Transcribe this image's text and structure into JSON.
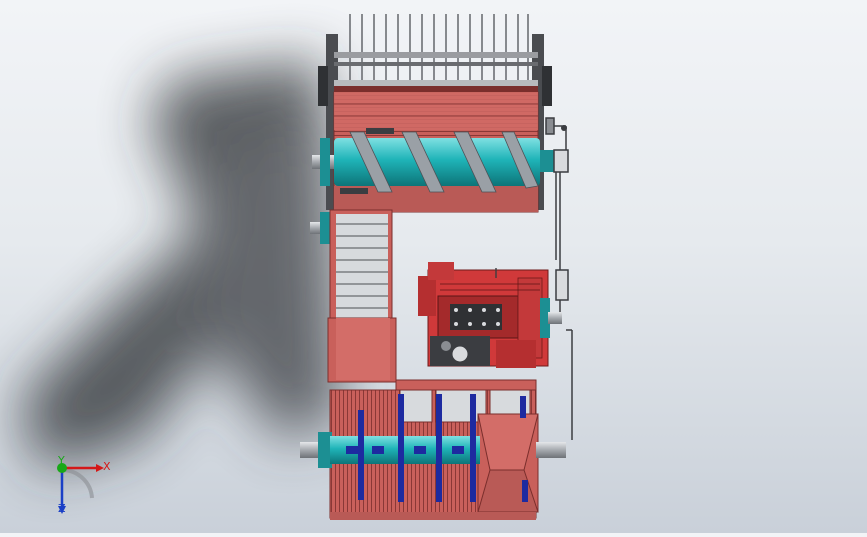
{
  "viewport": {
    "background_top": "#f2f4f7",
    "background_bottom": "#c9d0d9",
    "shadow_color": "#2a2d31"
  },
  "model": {
    "body_color": "#c9605b",
    "frame_color": "#b95a56",
    "auger_color": "#1fb4b8",
    "steel_color": "#8a8d92",
    "dark_steel": "#3b3d41",
    "blade_color": "#1d2aa0",
    "engine_color": "#d0393a"
  },
  "triad": {
    "x_label": "X",
    "y_label": "Y",
    "z_label": "Z",
    "x_color": "#d41818",
    "y_color": "#18a818",
    "z_color": "#1a3fc6"
  }
}
